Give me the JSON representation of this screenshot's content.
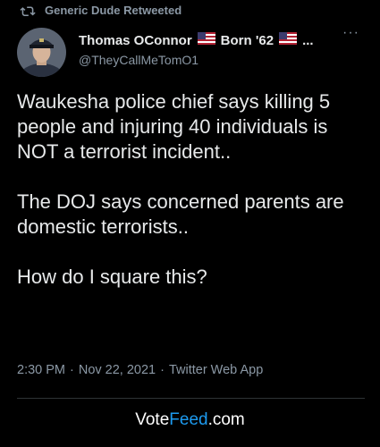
{
  "retweet": {
    "icon": "retweet-icon",
    "text": "Generic Dude Retweeted"
  },
  "author": {
    "name": "Thomas OConnor",
    "flag_icon": "us-flag-icon",
    "born": "Born '62",
    "truncation": "...",
    "handle": "@TheyCallMeTomO1"
  },
  "more_menu": "···",
  "tweet": {
    "paragraphs": [
      "Waukesha police chief says killing 5 people and injuring 40 individuals is NOT a terrorist incident..",
      "The DOJ says concerned parents are domestic terrorists..",
      "How do I square this?"
    ]
  },
  "meta": {
    "time": "2:30 PM",
    "separator": "·",
    "date": "Nov 22, 2021",
    "source": "Twitter Web App"
  },
  "footer": {
    "brand_prefix": "Vote",
    "brand_accent": "Feed",
    "brand_suffix": ".com"
  },
  "colors": {
    "background": "#000000",
    "text": "#e7e9ea",
    "secondary": "#8b98a5",
    "accent": "#1d9bf0",
    "divider": "#2f3336"
  }
}
